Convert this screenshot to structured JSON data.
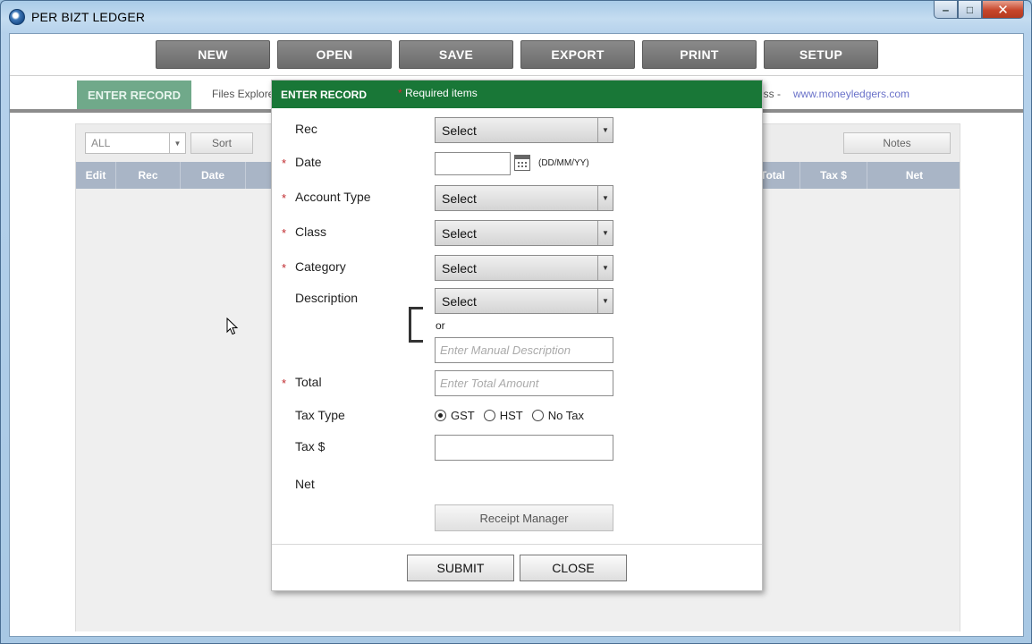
{
  "window": {
    "title": "PER BIZT LEDGER",
    "minimize": "‒",
    "maximize": "□",
    "close": "✕"
  },
  "toolbar": {
    "new": "NEW",
    "open": "OPEN",
    "save": "SAVE",
    "export": "EXPORT",
    "print": "PRINT",
    "setup": "SETUP"
  },
  "subbar": {
    "enter_record_tab": "ENTER RECORD",
    "files_explorer": "Files Explore",
    "ess_fragment": "ess -",
    "url": "www.moneyledgers.com"
  },
  "ledger": {
    "filter_value": "ALL",
    "sort_label": "Sort",
    "notes_label": "Notes",
    "columns": [
      "Edit",
      "Rec",
      "Date",
      "Total",
      "Tax $",
      "Net"
    ]
  },
  "dialog": {
    "title": "ENTER RECORD",
    "required_star": "*",
    "required_text": "Required items",
    "fields": {
      "rec": {
        "label": "Rec",
        "value": "Select"
      },
      "date": {
        "label": "Date",
        "hint": "(DD/MM/YY)",
        "value": ""
      },
      "account_type": {
        "label": "Account Type",
        "value": "Select"
      },
      "class": {
        "label": "Class",
        "value": "Select"
      },
      "category": {
        "label": "Category",
        "value": "Select"
      },
      "description": {
        "label": "Description",
        "value": "Select",
        "or_text": "or",
        "manual_placeholder": "Enter Manual Description"
      },
      "total": {
        "label": "Total",
        "placeholder": "Enter Total Amount"
      },
      "tax_type": {
        "label": "Tax Type",
        "options": [
          "GST",
          "HST",
          "No Tax"
        ],
        "selected": "GST"
      },
      "tax_amount": {
        "label": "Tax $",
        "value": ""
      },
      "net": {
        "label": "Net"
      }
    },
    "receipt_manager": "Receipt Manager",
    "submit": "SUBMIT",
    "close": "CLOSE"
  },
  "colors": {
    "dialog_header": "#197737",
    "enter_tab": "#70a98a",
    "toolbar_button": "#7a7a7a",
    "table_header": "#a9b5c6",
    "required_star": "#c0282d",
    "link": "#6a72c9"
  }
}
